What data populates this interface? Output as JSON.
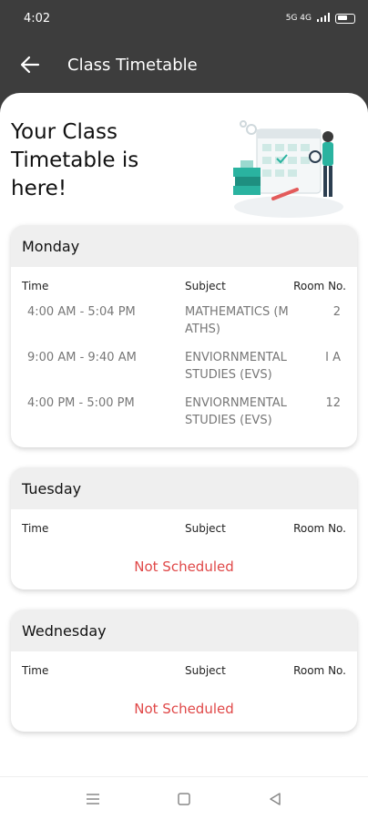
{
  "status_bar": {
    "time": "4:02",
    "network_text": "5G 4G"
  },
  "app_bar": {
    "title": "Class Timetable"
  },
  "hero": {
    "title": "Your Class Timetable is here!"
  },
  "columns": {
    "time": "Time",
    "subject": "Subject",
    "room": "Room No."
  },
  "days": [
    {
      "name": "Monday",
      "entries": [
        {
          "time": "4:00 AM - 5:04 PM",
          "subject": "MATHEMATICS (MATHS)",
          "room": "2"
        },
        {
          "time": "9:00 AM - 9:40 AM",
          "subject": "ENVIORNMENTAL STUDIES (EVS)",
          "room": "I A"
        },
        {
          "time": "4:00 PM - 5:00 PM",
          "subject": "ENVIORNMENTAL STUDIES (EVS)",
          "room": "12"
        }
      ]
    },
    {
      "name": "Tuesday",
      "status": "Not Scheduled"
    },
    {
      "name": "Wednesday",
      "status": "Not Scheduled"
    }
  ],
  "colors": {
    "header_bg": "#3d3d3d",
    "accent_teal": "#2ab3a0",
    "not_scheduled": "#e04848"
  },
  "nav_bar": {
    "icons": [
      "menu-icon",
      "home-square-icon",
      "back-triangle-icon"
    ]
  }
}
